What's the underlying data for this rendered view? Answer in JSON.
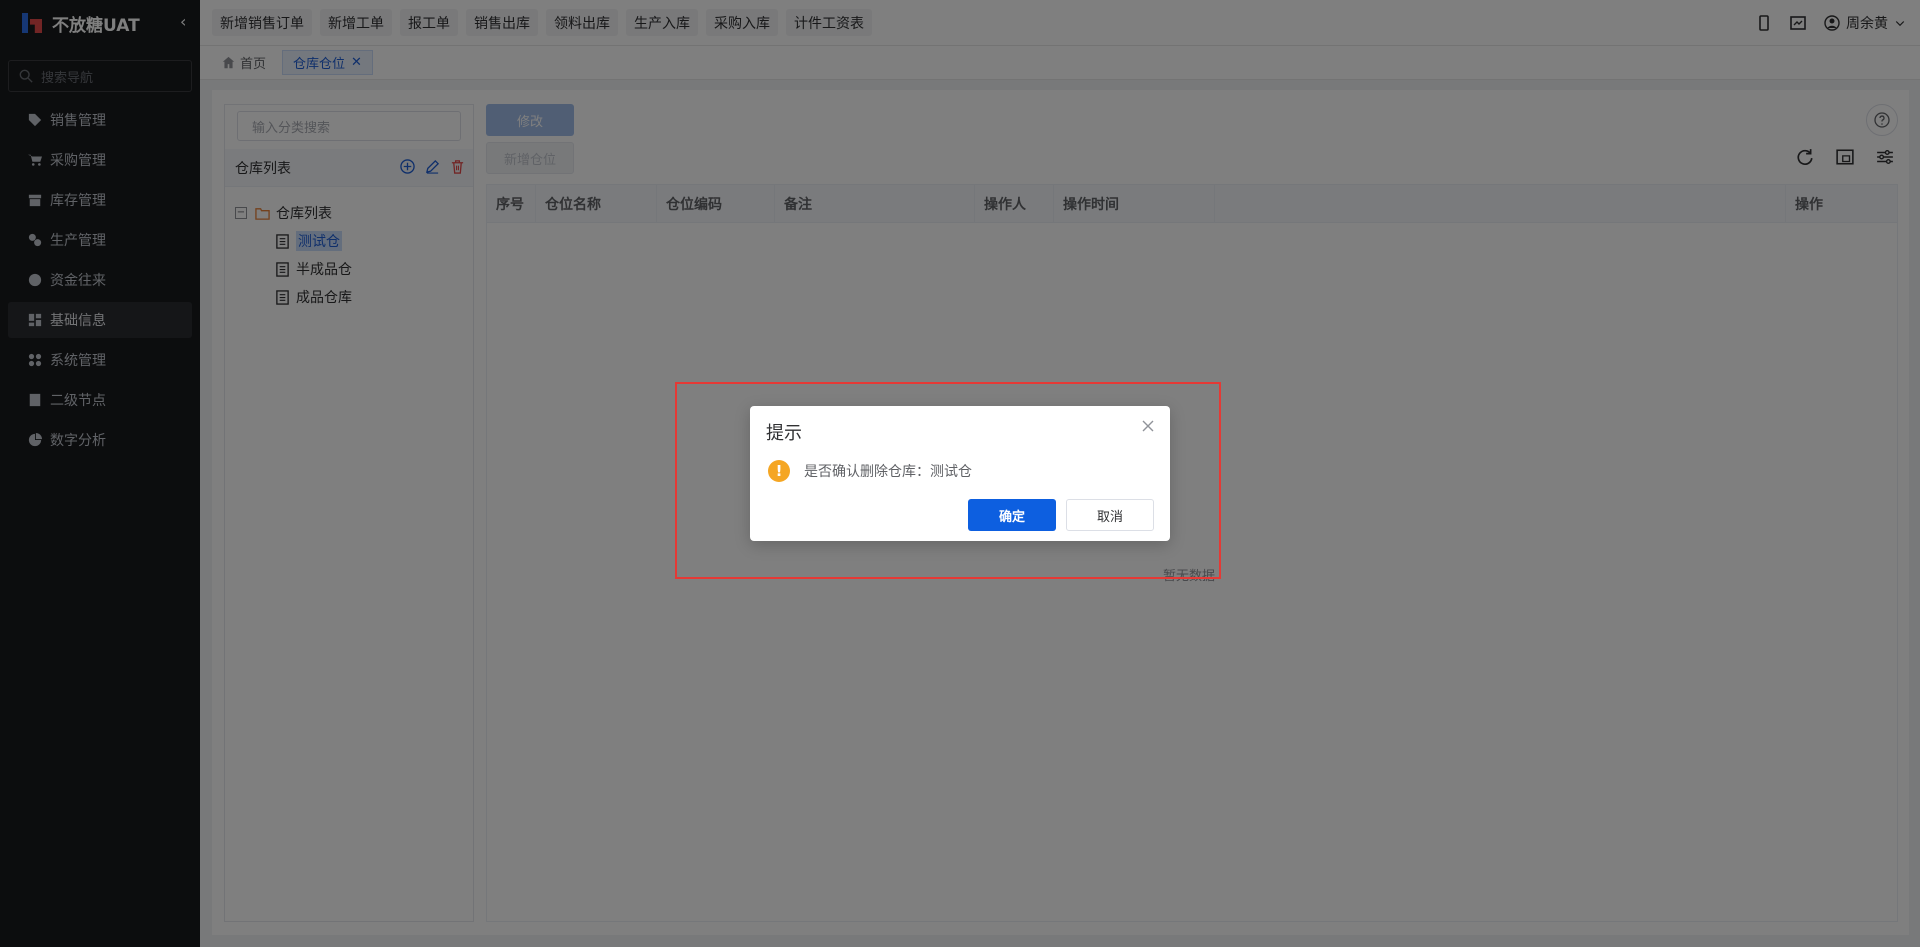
{
  "brand": {
    "name": "不放糖UAT"
  },
  "sidebar": {
    "search_placeholder": "搜索导航",
    "items": [
      {
        "label": "销售管理",
        "icon": "tag-icon"
      },
      {
        "label": "采购管理",
        "icon": "cart-icon"
      },
      {
        "label": "库存管理",
        "icon": "box-icon"
      },
      {
        "label": "生产管理",
        "icon": "cogs-icon"
      },
      {
        "label": "资金往来",
        "icon": "money-icon"
      },
      {
        "label": "基础信息",
        "icon": "dashboard-icon",
        "active": true
      },
      {
        "label": "系统管理",
        "icon": "grid-icon"
      },
      {
        "label": "二级节点",
        "icon": "doc-icon"
      },
      {
        "label": "数字分析",
        "icon": "pie-icon"
      }
    ]
  },
  "topbar": {
    "quick_buttons": [
      "新增销售订单",
      "新增工单",
      "报工单",
      "销售出库",
      "领料出库",
      "生产入库",
      "采购入库",
      "计件工资表"
    ],
    "user_name": "周余黄"
  },
  "tags": {
    "home": "首页",
    "current": "仓库仓位"
  },
  "tree": {
    "search_placeholder": "输入分类搜索",
    "header": "仓库列表",
    "root": "仓库列表",
    "children": [
      "测试仓",
      "半成品仓",
      "成品仓库"
    ]
  },
  "toolbar": {
    "edit_label": "修改",
    "add_label": "新增仓位"
  },
  "table": {
    "columns": [
      "序号",
      "仓位名称",
      "仓位编码",
      "备注",
      "操作人",
      "操作时间",
      "",
      "操作"
    ],
    "empty_text": "暂无数据"
  },
  "dialog": {
    "title": "提示",
    "message": "是否确认删除仓库：测试仓",
    "confirm_label": "确定",
    "cancel_label": "取消"
  },
  "colors": {
    "primary": "#0d5fe0",
    "sidebar_bg": "#191a1d",
    "warning": "#f5a623",
    "highlight_box": "#e53935"
  }
}
